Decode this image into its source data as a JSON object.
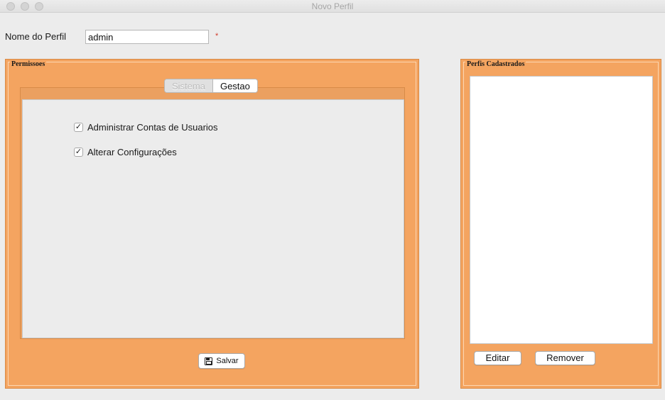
{
  "window": {
    "title": "Novo Perfil"
  },
  "profile": {
    "label": "Nome do Perfil",
    "value": "admin",
    "required_marker": "*"
  },
  "permissions": {
    "title": "Permissoes",
    "tabs": [
      {
        "label": "Sistema",
        "selected": true
      },
      {
        "label": "Gestao",
        "selected": false
      }
    ],
    "checkboxes": [
      {
        "label": "Administrar Contas de Usuarios",
        "checked": true
      },
      {
        "label": "Alterar Configurações",
        "checked": true
      }
    ],
    "save_button": {
      "label": "Salvar",
      "icon": "save-icon"
    }
  },
  "profiles": {
    "title": "Perfis Cadastrados",
    "items": [],
    "edit_button": "Editar",
    "remove_button": "Remover"
  },
  "colors": {
    "panel": "#f4a460",
    "background": "#ececec"
  }
}
